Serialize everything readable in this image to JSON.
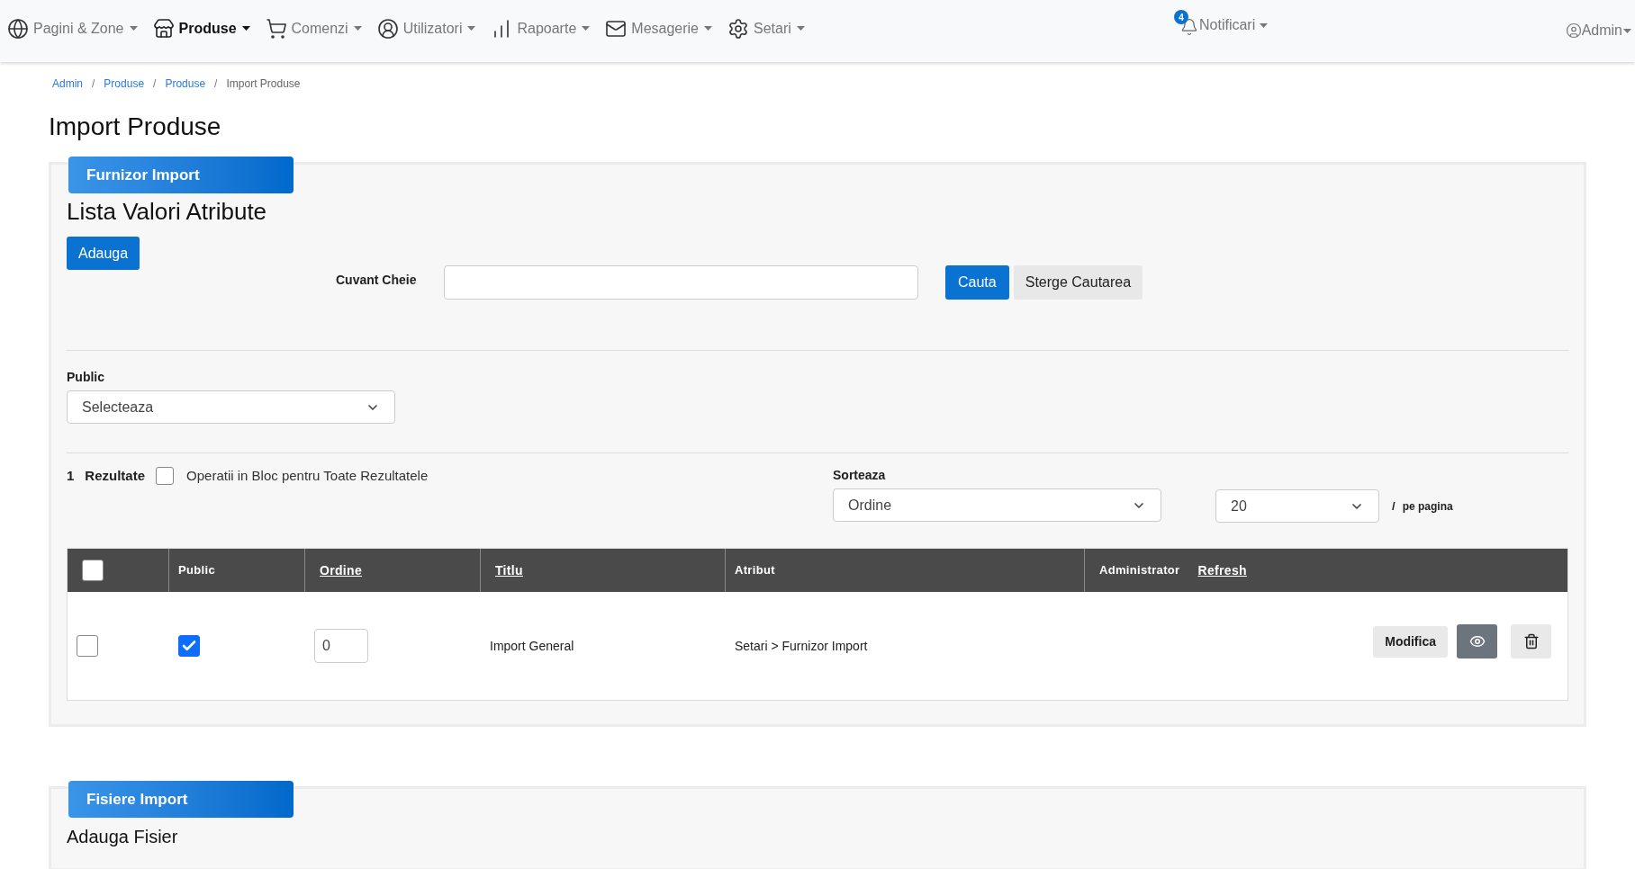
{
  "nav": {
    "items": [
      {
        "label": "Pagini & Zone",
        "selected": false
      },
      {
        "label": "Produse",
        "selected": true
      },
      {
        "label": "Comenzi",
        "selected": false
      },
      {
        "label": "Utilizatori",
        "selected": false
      },
      {
        "label": "Rapoarte",
        "selected": false
      },
      {
        "label": "Mesagerie",
        "selected": false
      },
      {
        "label": "Setari",
        "selected": false
      }
    ],
    "notifications": {
      "label": "Notificari",
      "count": "4"
    },
    "user": {
      "label": "Admin"
    }
  },
  "breadcrumb": [
    {
      "label": "Admin",
      "kind": "link",
      "separator": "/"
    },
    {
      "label": "Produse",
      "kind": "link",
      "separator": "/"
    },
    {
      "label": "Produse",
      "kind": "link",
      "separator": "/"
    },
    {
      "label": "Import Produse",
      "kind": "current"
    }
  ],
  "page_title": "Import Produse",
  "panels": [
    {
      "tab": "Furnizor Import",
      "heading": "Lista Valori Atribute",
      "add_button": "Adauga",
      "search": {
        "label": "Cuvant Cheie",
        "search_button": "Cauta",
        "clear_button": "Sterge Cautarea"
      },
      "filter": {
        "label": "Public",
        "value": "Selecteaza"
      },
      "results": {
        "count": "1",
        "label": "Rezultate",
        "bulk_checked": false,
        "bulk_label": "Operatii in Bloc pentru Toate Rezultatele"
      },
      "sort": {
        "label": "Sorteaza",
        "value": "Ordine",
        "per_page": "20",
        "separator": "/",
        "per_page_label": "pe pagina"
      },
      "table": {
        "columns": [
          {
            "kind": "checkbox",
            "checked": false
          },
          {
            "kind": "text",
            "label": "Public"
          },
          {
            "kind": "link",
            "label": "Ordine"
          },
          {
            "kind": "link",
            "label": "Titlu"
          },
          {
            "kind": "text",
            "label": "Atribut"
          },
          {
            "kind": "admin",
            "label": "Administrator",
            "link": "Refresh"
          }
        ],
        "rows": [
          {
            "checked": false,
            "public": true,
            "order": "0",
            "title": "Import General",
            "atribut": "Setari > Furnizor Import",
            "edit_button": "Modifica"
          }
        ]
      }
    },
    {
      "tab": "Fisiere Import",
      "heading": "Adauga Fisier"
    }
  ]
}
